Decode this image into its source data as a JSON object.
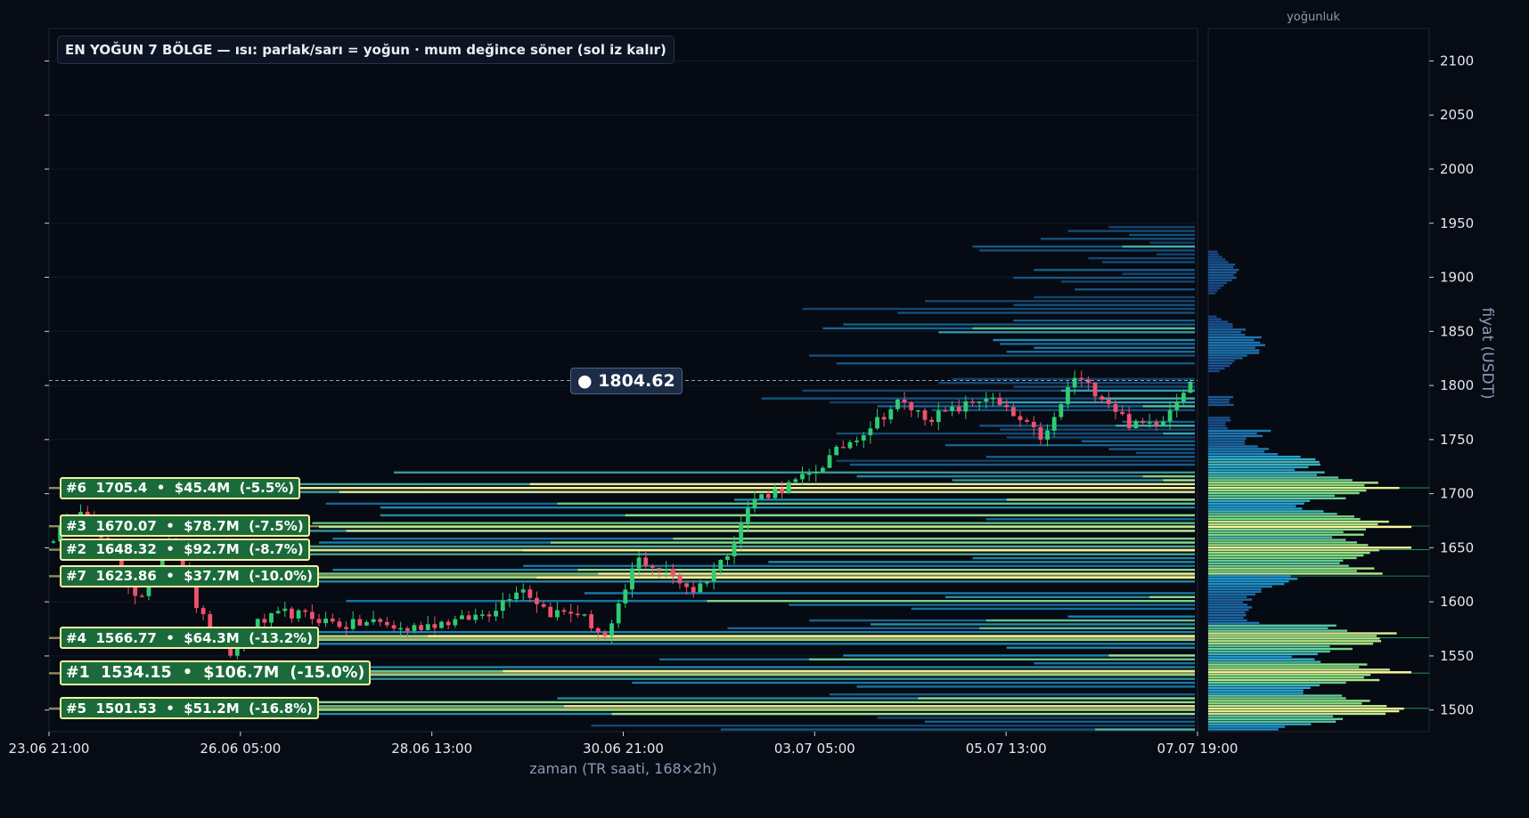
{
  "chart_data": {
    "type": "candlestick-heatmap",
    "title": "EN YOĞUN 7 BÖLGE — ısı: parlak/sarı = yoğun · mum değince söner (sol iz kalır)",
    "xlabel": "zaman (TR saati, 168×2h)",
    "ylabel": "fiyat (USDT)",
    "side_panel_title": "yoğunluk",
    "ylim": [
      1480,
      2130
    ],
    "yticks": [
      1500,
      1550,
      1600,
      1650,
      1700,
      1750,
      1800,
      1850,
      1900,
      1950,
      2000,
      2050,
      2100
    ],
    "xticks": [
      "23.06 21:00",
      "26.06 05:00",
      "28.06 13:00",
      "30.06 21:00",
      "03.07 05:00",
      "05.07 13:00",
      "07.07 19:00"
    ],
    "bars_count": 168,
    "current_price": 1804.62,
    "current_price_label": "● 1804.62",
    "zones": [
      {
        "rank": 1,
        "price": 1534.15,
        "value": "$106.7M",
        "pct": "-15.0%",
        "label": "#1  1534.15  •  $106.7M  (-15.0%)"
      },
      {
        "rank": 2,
        "price": 1648.32,
        "value": "$92.7M",
        "pct": "-8.7%",
        "label": "#2  1648.32  •  $92.7M  (-8.7%)"
      },
      {
        "rank": 3,
        "price": 1670.07,
        "value": "$78.7M",
        "pct": "-7.5%",
        "label": "#3  1670.07  •  $78.7M  (-7.5%)"
      },
      {
        "rank": 4,
        "price": 1566.77,
        "value": "$64.3M",
        "pct": "-13.2%",
        "label": "#4  1566.77  •  $64.3M  (-13.2%)"
      },
      {
        "rank": 5,
        "price": 1501.53,
        "value": "$51.2M",
        "pct": "-16.8%",
        "label": "#5  1501.53  •  $51.2M  (-16.8%)"
      },
      {
        "rank": 6,
        "price": 1705.4,
        "value": "$45.4M",
        "pct": "-5.5%",
        "label": "#6  1705.4  •  $45.4M  (-5.5%)"
      },
      {
        "rank": 7,
        "price": 1623.86,
        "value": "$37.7M",
        "pct": "-10.0%",
        "label": "#7  1623.86  •  $37.7M  (-10.0%)"
      }
    ],
    "price_path": [
      [
        0,
        1660
      ],
      [
        6,
        1690
      ],
      [
        12,
        1640
      ],
      [
        18,
        1600
      ],
      [
        24,
        1665
      ],
      [
        30,
        1590
      ],
      [
        36,
        1550
      ],
      [
        42,
        1580
      ],
      [
        48,
        1590
      ],
      [
        54,
        1585
      ],
      [
        60,
        1578
      ],
      [
        66,
        1582
      ],
      [
        72,
        1574
      ],
      [
        78,
        1580
      ],
      [
        84,
        1583
      ],
      [
        90,
        1591
      ],
      [
        96,
        1615
      ],
      [
        102,
        1590
      ],
      [
        108,
        1590
      ],
      [
        114,
        1565
      ],
      [
        120,
        1640
      ],
      [
        126,
        1628
      ],
      [
        132,
        1610
      ],
      [
        138,
        1640
      ],
      [
        144,
        1695
      ],
      [
        150,
        1705
      ],
      [
        156,
        1718
      ],
      [
        162,
        1742
      ],
      [
        168,
        1762
      ],
      [
        174,
        1785
      ],
      [
        180,
        1770
      ],
      [
        186,
        1778
      ],
      [
        192,
        1790
      ],
      [
        198,
        1770
      ],
      [
        204,
        1750
      ],
      [
        210,
        1808
      ],
      [
        216,
        1790
      ],
      [
        222,
        1762
      ],
      [
        228,
        1768
      ],
      [
        234,
        1806
      ]
    ],
    "colors": {
      "background": "#070b14",
      "candle_up": "#2ecc71",
      "candle_down": "#f0506e",
      "heat_low": "#1a3a7a",
      "heat_mid": "#1fa0d8",
      "heat_high": "#7fdc80",
      "heat_peak": "#fff59a",
      "zone_label_bg": "#1b6b3a",
      "zone_label_border": "#f5f0a0"
    }
  }
}
